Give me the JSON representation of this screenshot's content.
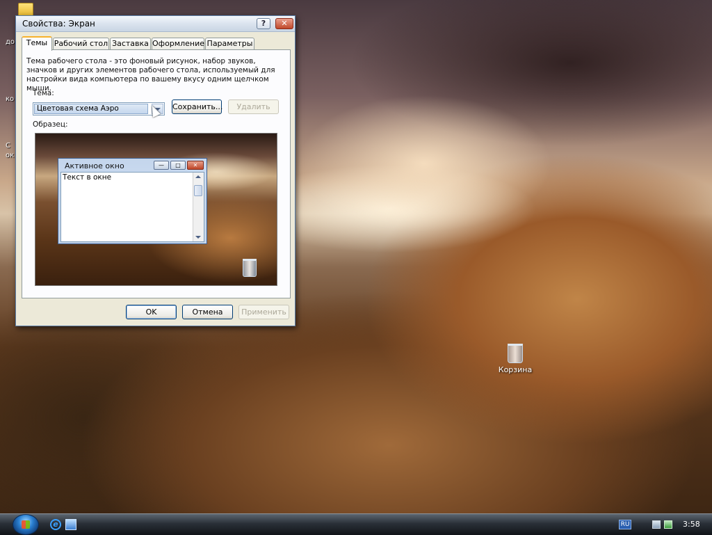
{
  "desktop": {
    "left_labels": [
      "до",
      "ко",
      "С",
      "ок"
    ],
    "recycle_bin_label": "Корзина"
  },
  "dialog": {
    "title": "Свойства: Экран",
    "help_glyph": "?",
    "close_glyph": "✕",
    "tabs": [
      {
        "label": "Темы",
        "active": true
      },
      {
        "label": "Рабочий стол",
        "active": false
      },
      {
        "label": "Заставка",
        "active": false
      },
      {
        "label": "Оформление",
        "active": false
      },
      {
        "label": "Параметры",
        "active": false
      }
    ],
    "description": "Тема рабочего стола - это фоновый рисунок, набор звуков, значков и других элементов рабочего стола, используемый для настройки вида компьютера по вашему вкусу одним щелчком мыши.",
    "theme_label": "Тема:",
    "theme_value": "Цветовая схема Аэро",
    "save_button": "Сохранить...",
    "delete_button": "Удалить",
    "sample_label": "Образец:",
    "preview": {
      "window_title": "Активное окно",
      "window_text": "Текст в окне",
      "min_glyph": "—",
      "max_glyph": "□",
      "close_glyph": "✕"
    },
    "ok_button": "OK",
    "cancel_button": "Отмена",
    "apply_button": "Применить"
  },
  "taskbar": {
    "language": "RU",
    "ie_glyph": "e",
    "clock": "3:58"
  }
}
